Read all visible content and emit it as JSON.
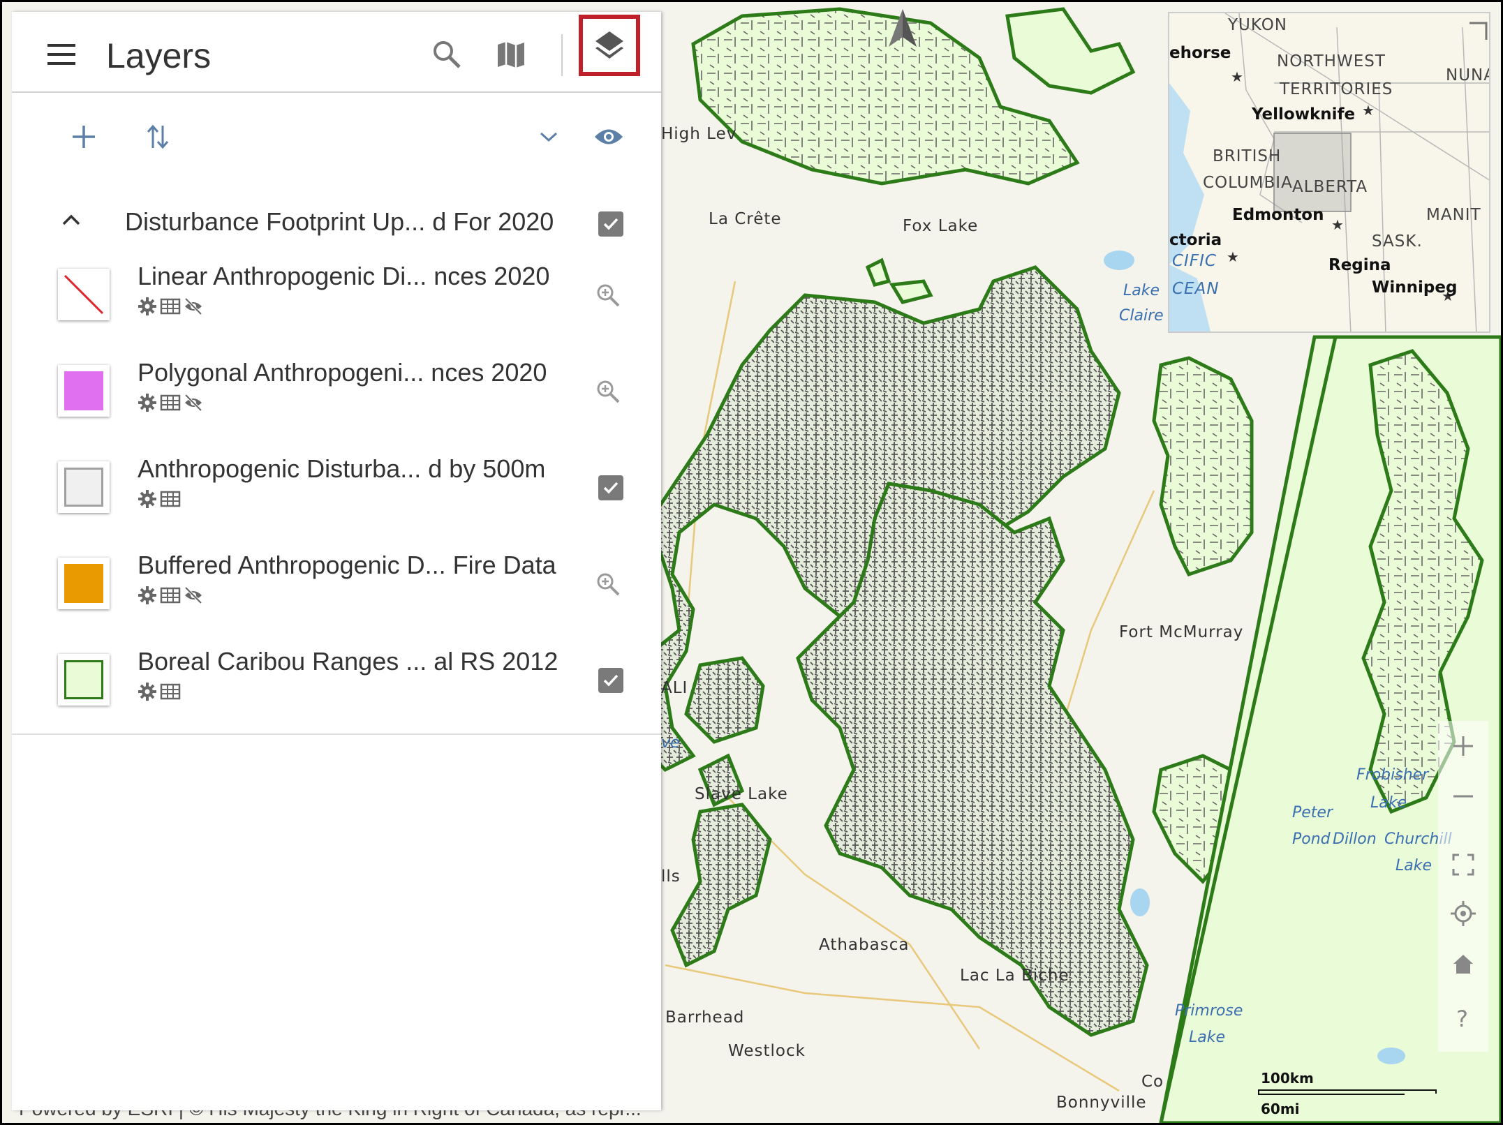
{
  "header": {
    "title": "Layers",
    "icons": {
      "menu": "hamburger-icon",
      "search": "search-icon",
      "basemap": "map-icon",
      "layers": "layers-icon"
    }
  },
  "toolbar": {
    "icons": [
      "add-icon",
      "sort-icon",
      "chevron-down-icon",
      "eye-icon"
    ]
  },
  "group": {
    "title": "Disturbance Footprint Up... d For 2020",
    "checked": true
  },
  "layers": [
    {
      "name": "Linear Anthropogenic Di... nces 2020",
      "symbol": "line",
      "color": "#e0242c",
      "icons": [
        "gear-icon",
        "table-icon",
        "visibility-off-icon"
      ],
      "action": "zoom"
    },
    {
      "name": "Polygonal Anthropogeni... nces 2020",
      "symbol": "fill",
      "color": "#e070f0",
      "icons": [
        "gear-icon",
        "table-icon",
        "visibility-off-icon"
      ],
      "action": "zoom"
    },
    {
      "name": "Anthropogenic Disturba... d by 500m",
      "symbol": "fill-outline",
      "color": "#f0f0f0",
      "outline": "#a0a0a0",
      "icons": [
        "gear-icon",
        "table-icon"
      ],
      "action": "checkbox"
    },
    {
      "name": "Buffered Anthropogenic D... Fire Data",
      "symbol": "fill",
      "color": "#e89a00",
      "icons": [
        "gear-icon",
        "table-icon",
        "visibility-off-icon"
      ],
      "action": "zoom"
    },
    {
      "name": "Boreal Caribou Ranges ... al RS 2012",
      "symbol": "fill-outline",
      "color": "#eafbd8",
      "outline": "#2c7a18",
      "icons": [
        "gear-icon",
        "table-icon"
      ],
      "action": "checkbox"
    }
  ],
  "attribution": "Powered by ESRI | © His Majesty the King in Right of Canada, as repr...",
  "map": {
    "labels": [
      {
        "text": "High Lev"
      },
      {
        "text": "La Crête"
      },
      {
        "text": "Fox Lake"
      },
      {
        "text": "Fort McMurray"
      },
      {
        "text": "Slave Lake"
      },
      {
        "text": "Athabasca"
      },
      {
        "text": "Lac La Biche"
      },
      {
        "text": "Barrhead"
      },
      {
        "text": "Westlock"
      },
      {
        "text": "Bonnyville"
      },
      {
        "text": "Co"
      },
      {
        "text": "ALI"
      },
      {
        "text": "lls"
      }
    ],
    "water_labels": [
      {
        "text": "Lake"
      },
      {
        "text": "Claire"
      },
      {
        "text": "Frobisher"
      },
      {
        "text": "Lake"
      },
      {
        "text": "Peter"
      },
      {
        "text": "Pond"
      },
      {
        "text": "Dillon"
      },
      {
        "text": "Churchill"
      },
      {
        "text": "Lake"
      },
      {
        "text": "Primrose"
      },
      {
        "text": "Lake"
      },
      {
        "text": "ve"
      }
    ],
    "colors": {
      "range_fill": "#eafbd8",
      "range_outline": "#2c7a18",
      "disturbance": "#555555",
      "base": "#f4f3ec"
    }
  },
  "overview": {
    "labels": [
      {
        "text": "YUKON",
        "type": "region"
      },
      {
        "text": "ehorse",
        "type": "city"
      },
      {
        "text": "NORTHWEST",
        "type": "region"
      },
      {
        "text": "TERRITORIES",
        "type": "region"
      },
      {
        "text": "NUNA",
        "type": "region"
      },
      {
        "text": "Yellowknife",
        "type": "city"
      },
      {
        "text": "BRITISH",
        "type": "region"
      },
      {
        "text": "COLUMBIA",
        "type": "region"
      },
      {
        "text": "ALBERTA",
        "type": "region"
      },
      {
        "text": "Edmonton",
        "type": "city"
      },
      {
        "text": "MANIT",
        "type": "region"
      },
      {
        "text": "ctoria",
        "type": "city"
      },
      {
        "text": "SASK.",
        "type": "region"
      },
      {
        "text": "CIFIC",
        "type": "water"
      },
      {
        "text": "Regina",
        "type": "city"
      },
      {
        "text": "CEAN",
        "type": "water"
      },
      {
        "text": "Winnipeg",
        "type": "city"
      }
    ]
  },
  "controls": {
    "icons": [
      "zoom-in-icon",
      "zoom-out-icon",
      "fullscreen-icon",
      "locate-icon",
      "home-icon",
      "help-icon"
    ]
  },
  "scale": {
    "km": "100km",
    "mi": "60mi"
  }
}
